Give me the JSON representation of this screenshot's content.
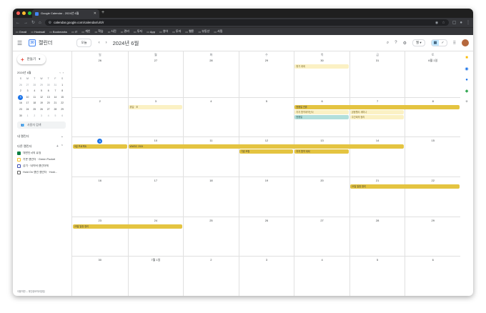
{
  "browser": {
    "tab_title": "Google Calendar - 2024년 6월",
    "url": "calendar.google.com/calendar/u/0/r",
    "bookmarks": [
      "Gmail",
      "Hostwall",
      "Bookmarks",
      "IT",
      "개인",
      "학습",
      "사진",
      "관리",
      "투자",
      "App",
      "영어",
      "투자",
      "웹툰",
      "부동산",
      "서핑"
    ]
  },
  "header": {
    "app_name": "캘린더",
    "today_label": "오늘",
    "period": "2024년 6월",
    "view_label": "월"
  },
  "sidebar": {
    "create_label": "만들기",
    "mini_month": "2024년 6월",
    "dow": [
      "S",
      "M",
      "T",
      "W",
      "T",
      "F",
      "S"
    ],
    "mini_days": [
      [
        "26",
        "27",
        "28",
        "29",
        "30",
        "31",
        "1"
      ],
      [
        "2",
        "3",
        "4",
        "5",
        "6",
        "7",
        "8"
      ],
      [
        "9",
        "10",
        "11",
        "12",
        "13",
        "14",
        "15"
      ],
      [
        "16",
        "17",
        "18",
        "19",
        "20",
        "21",
        "22"
      ],
      [
        "23",
        "24",
        "25",
        "26",
        "27",
        "28",
        "29"
      ],
      [
        "30",
        "1",
        "2",
        "3",
        "4",
        "5",
        "6"
      ]
    ],
    "search_people": "사용자 검색",
    "my_calendars": "내 캘린더",
    "other_calendars": "다른 캘린더",
    "calendars": [
      "대한민국의 휴일",
      "기본 캘린더 · Green Pocket",
      "장기 · 네이버 캘린더에",
      "Hold On 캘린 캘린더 · Hold..."
    ],
    "footer": "이용약관 – 개인정보처리방침"
  },
  "grid": {
    "dow": [
      "일",
      "월",
      "화",
      "수",
      "목",
      "금",
      "토"
    ],
    "weeks": [
      [
        "26",
        "27",
        "28",
        "29",
        "30",
        "31",
        "6월 1일"
      ],
      [
        "2",
        "3",
        "4",
        "5",
        "6",
        "7",
        "8"
      ],
      [
        "9",
        "10",
        "11",
        "12",
        "13",
        "14",
        "15"
      ],
      [
        "16",
        "17",
        "18",
        "19",
        "20",
        "21",
        "22"
      ],
      [
        "23",
        "24",
        "25",
        "26",
        "27",
        "28",
        "29"
      ],
      [
        "30",
        "7월 1일",
        "2",
        "3",
        "4",
        "5",
        "6"
      ]
    ],
    "events": [
      {
        "week": 0,
        "start": 4,
        "span": 1,
        "style": "pale",
        "label": "휴가 계획"
      },
      {
        "week": 1,
        "start": 1,
        "span": 1,
        "style": "pale",
        "label": "휴일 · 조"
      },
      {
        "week": 1,
        "start": 4,
        "span": 3,
        "style": "solid",
        "label": "현충일 연휴"
      },
      {
        "week": 1,
        "start": 4,
        "span": 1,
        "style": "pale",
        "label": "지지 협약계약신사",
        "row": 1
      },
      {
        "week": 1,
        "start": 5,
        "span": 1,
        "style": "pale",
        "label": "공동행사 세미나",
        "row": 1
      },
      {
        "week": 1,
        "start": 4,
        "span": 1,
        "style": "teal",
        "label": "현충일",
        "row": 2
      },
      {
        "week": 1,
        "start": 5,
        "span": 1,
        "style": "pale",
        "label": "주간회의 정리",
        "row": 2
      },
      {
        "week": 2,
        "start": 0,
        "span": 1,
        "style": "solid",
        "label": "9일 프로젝트"
      },
      {
        "week": 2,
        "start": 1,
        "span": 5,
        "style": "solid",
        "label": "WWDC 2024"
      },
      {
        "week": 2,
        "start": 3,
        "span": 1,
        "style": "solid",
        "label": "기념 조형",
        "row": 1
      },
      {
        "week": 2,
        "start": 4,
        "span": 1,
        "style": "solid",
        "label": "지지 협약 계획",
        "row": 1
      },
      {
        "week": 3,
        "start": 5,
        "span": 2,
        "style": "solid",
        "label": "21일 일정 정리"
      },
      {
        "week": 4,
        "start": 0,
        "span": 2,
        "style": "solid",
        "label": "23일 일정 정리"
      }
    ]
  },
  "colors": {
    "accent": "#1a73e8",
    "event_solid": "#e4c441",
    "event_pale": "#fbf1c4",
    "event_teal": "#b2dfdb"
  }
}
